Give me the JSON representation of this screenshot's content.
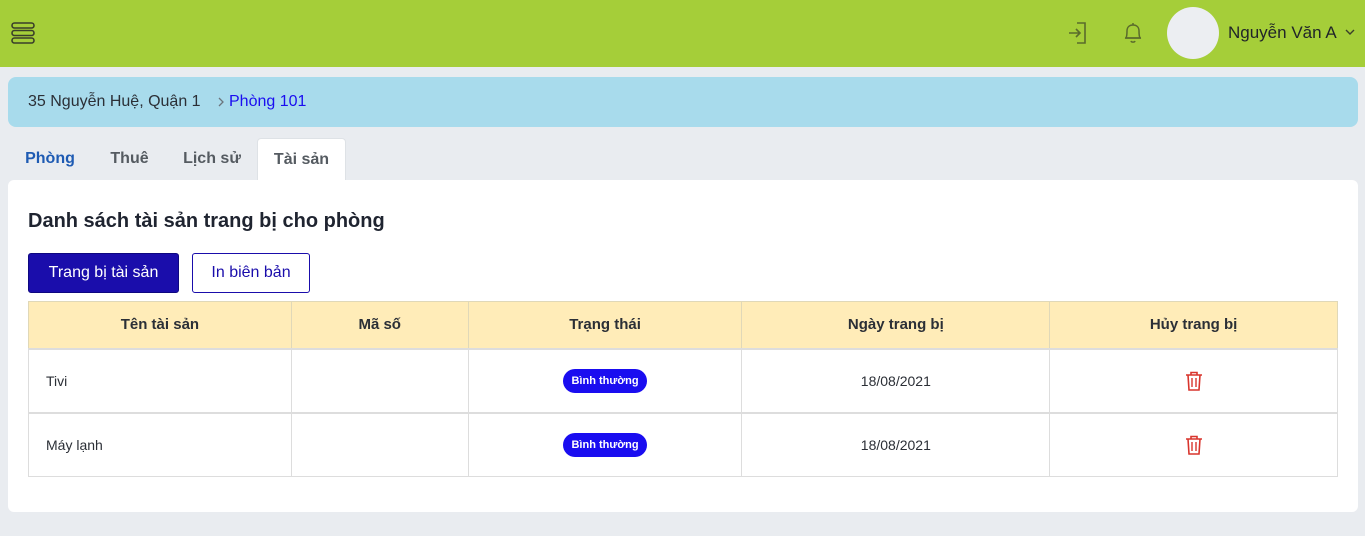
{
  "header": {
    "user_name": "Nguyễn Văn A",
    "accent_color": "#a5ce39"
  },
  "breadcrumb": {
    "parent": "35 Nguyễn Huệ, Quận 1",
    "current": "Phòng 101"
  },
  "tabs": [
    {
      "label": "Phòng"
    },
    {
      "label": "Thuê"
    },
    {
      "label": "Lịch sử"
    },
    {
      "label": "Tài sản",
      "active": true
    }
  ],
  "main": {
    "title": "Danh sách tài sản trang bị cho phòng",
    "equip_button": "Trang bị tài sản",
    "print_button": "In biên bản"
  },
  "table": {
    "headers": [
      "Tên tài sản",
      "Mã số",
      "Trạng thái",
      "Ngày trang bị",
      "Hủy trang bị"
    ],
    "rows": [
      {
        "name": "Tivi",
        "code": "",
        "status": "Bình thường",
        "date": "18/08/2021"
      },
      {
        "name": "Máy lạnh",
        "code": "",
        "status": "Bình thường",
        "date": "18/08/2021"
      }
    ]
  }
}
